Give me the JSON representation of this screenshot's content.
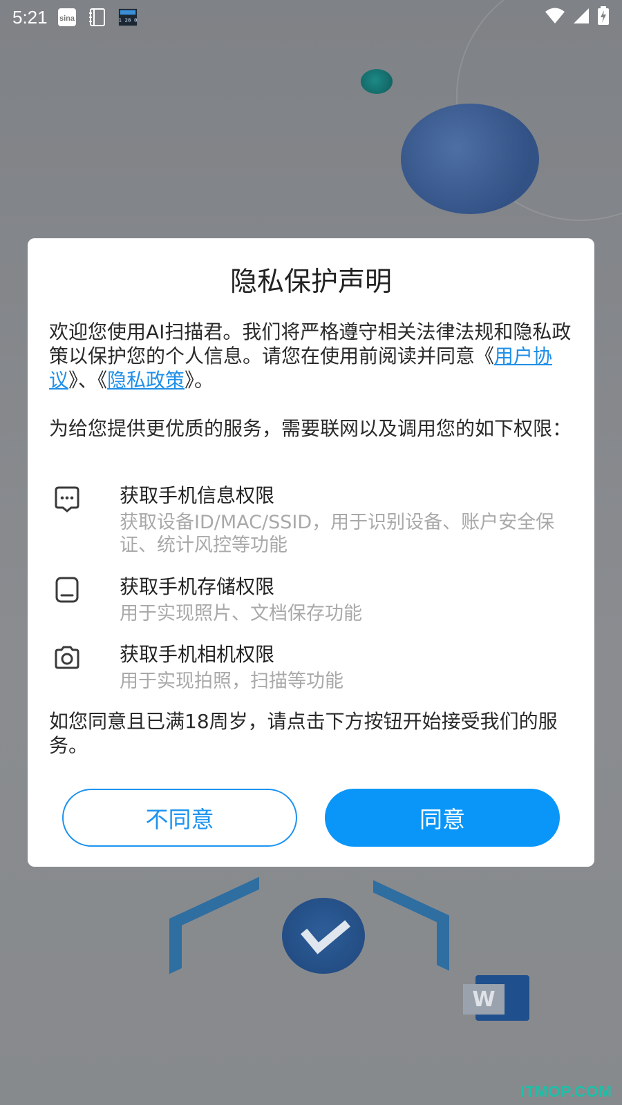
{
  "status_bar": {
    "time": "5:21",
    "left_icons": [
      "sina-weibo-icon",
      "notebook-icon",
      "clock-widget-icon"
    ],
    "right_icons": [
      "wifi-icon",
      "cell-signal-icon",
      "battery-charging-icon"
    ]
  },
  "dialog": {
    "title": "隐私保护声明",
    "intro": {
      "text_before": "欢迎您使用AI扫描君。我们将严格遵守相关法律法规和隐私政策以保护您的个人信息。请您在使用前阅读并同意《",
      "link_user_agreement": "用户协议",
      "text_between": "》、《",
      "link_privacy_policy": "隐私政策",
      "text_after": "》。"
    },
    "service_note": "为给您提供更优质的服务，需要联网以及调用您的如下权限：",
    "permissions": [
      {
        "icon": "phone-info-icon",
        "title": "获取手机信息权限",
        "description": "获取设备ID/MAC/SSID，用于识别设备、账户安全保证、统计风控等功能"
      },
      {
        "icon": "storage-icon",
        "title": "获取手机存储权限",
        "description": "用于实现照片、文档保存功能"
      },
      {
        "icon": "camera-icon",
        "title": "获取手机相机权限",
        "description": "用于实现拍照，扫描等功能"
      }
    ],
    "age_note": "如您同意且已满18周岁，请点击下方按钮开始接受我们的服务。",
    "buttons": {
      "disagree": "不同意",
      "agree": "同意"
    }
  },
  "watermark": "ITMOP.COM",
  "colors": {
    "accent": "#0a96f8",
    "link": "#1f8fe8",
    "muted_text": "#a9a9a9",
    "overlay": "#7d8084"
  }
}
